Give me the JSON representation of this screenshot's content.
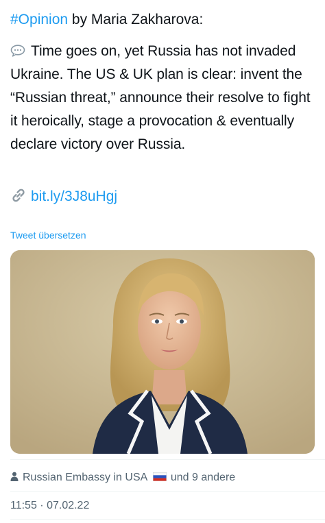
{
  "tweet": {
    "headline": {
      "hashtag": "#Opinion",
      "rest": " by Maria Zakharova:"
    },
    "body_icon": "speech-bubble-icon",
    "body": "Time goes on, yet Russia has not invaded Ukraine. The US & UK plan is clear: invent the “Russian threat,” announce their resolve to fight it heroically, stage a provocation & eventually declare victory over Russia.",
    "link_icon": "link-icon",
    "link": "bit.ly/3J8uHgj",
    "translate_label": "Tweet übersetzen",
    "image": "photo of woman with blonde hair in dark blazer",
    "likes": {
      "icon": "person-icon",
      "account": "Russian Embassy in USA",
      "flag_icon": "russia-flag-icon",
      "others": "und 9 andere"
    },
    "timestamp": "11:55 · 07.02.22"
  },
  "colors": {
    "link": "#1d9bf0",
    "text": "#0f1419",
    "secondary": "#536471"
  }
}
